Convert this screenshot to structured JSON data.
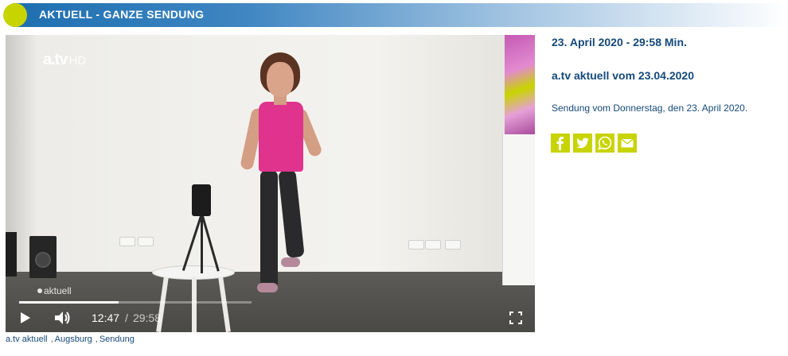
{
  "header": {
    "title": "AKTUELL - GANZE SENDUNG"
  },
  "video": {
    "channel_logo": "a.tv",
    "channel_logo_suffix": "HD",
    "watermark": "aktuell",
    "current_time": "12:47",
    "separator": "/",
    "duration": "29:58",
    "progress": 0.427,
    "icons": {
      "play": "play-icon",
      "volume": "volume-icon",
      "fullscreen": "fullscreen-icon"
    }
  },
  "tags": [
    "a.tv aktuell",
    "Augsburg",
    "Sendung"
  ],
  "info": {
    "date_line": "23. April 2020 - 29:58 Min.",
    "title": "a.tv aktuell vom 23.04.2020",
    "description": "Sendung vom Donnerstag, den 23. April 2020."
  },
  "share": {
    "buttons": [
      "facebook-icon",
      "twitter-icon",
      "whatsapp-icon",
      "email-icon"
    ],
    "color": "#c8d400"
  },
  "colors": {
    "accent": "#c8d400",
    "heading": "#14497a",
    "header_blue": "#1e6fb0"
  }
}
